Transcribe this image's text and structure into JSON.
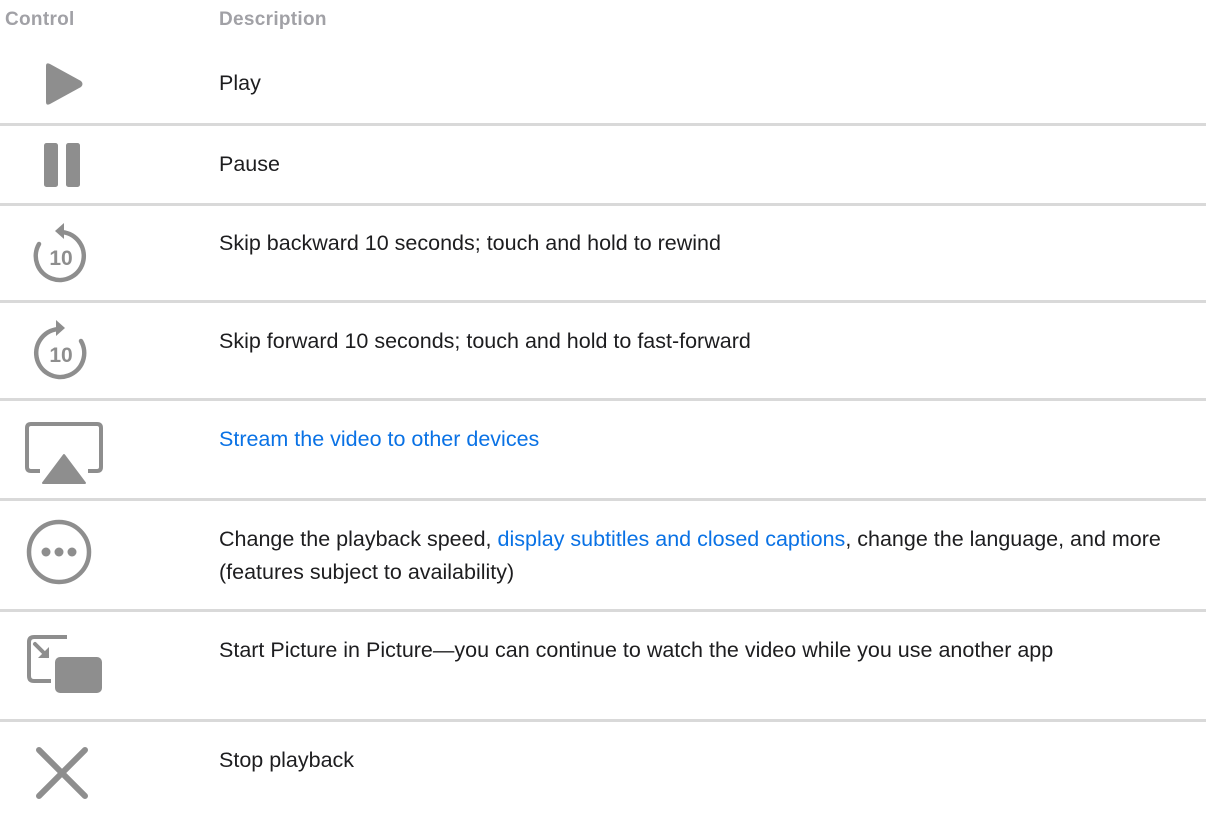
{
  "header": {
    "control": "Control",
    "description": "Description"
  },
  "rows": [
    {
      "icon": "play-icon",
      "text": "Play"
    },
    {
      "icon": "pause-icon",
      "text": "Pause"
    },
    {
      "icon": "skip-backward-10-icon",
      "icon_label": "10",
      "text": "Skip backward 10 seconds; touch and hold to rewind"
    },
    {
      "icon": "skip-forward-10-icon",
      "icon_label": "10",
      "text": "Skip forward 10 seconds; touch and hold to fast-forward"
    },
    {
      "icon": "airplay-icon",
      "link_text": "Stream the video to other devices"
    },
    {
      "icon": "more-icon",
      "text_before": "Change the playback speed, ",
      "link_text": "display subtitles and closed captions",
      "text_after": ", change the language, and more (features subject to availability)"
    },
    {
      "icon": "picture-in-picture-icon",
      "text": "Start Picture in Picture—you can continue to watch the video while you use another app"
    },
    {
      "icon": "close-icon",
      "text": "Stop playback"
    }
  ],
  "colors": {
    "icon": "#8e8e8e",
    "link": "#0a72e5",
    "header_text": "#a1a1a6",
    "divider": "#d9d9d9"
  }
}
